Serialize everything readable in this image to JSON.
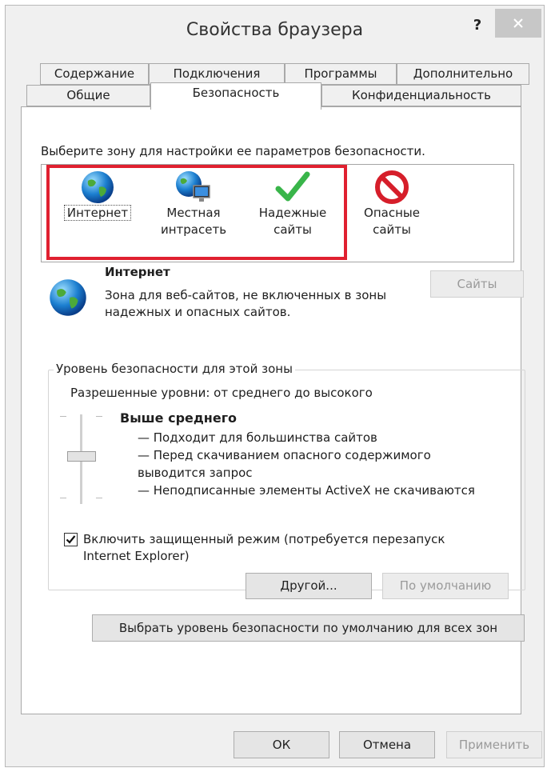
{
  "window": {
    "title": "Свойства браузера",
    "help": "?",
    "close_icon": "close-icon"
  },
  "tabs": {
    "row1": [
      "Содержание",
      "Подключения",
      "Программы",
      "Дополнительно"
    ],
    "row2": [
      "Общие",
      "Безопасность",
      "Конфиденциальность"
    ],
    "active": "Безопасность"
  },
  "zones": {
    "prompt": "Выберите зону для настройки ее параметров безопасности.",
    "items": [
      {
        "line1": "Интернет",
        "line2": "",
        "icon": "globe-icon"
      },
      {
        "line1": "Местная",
        "line2": "интрасеть",
        "icon": "intranet-icon"
      },
      {
        "line1": "Надежные",
        "line2": "сайты",
        "icon": "checkmark-icon"
      },
      {
        "line1": "Опасные",
        "line2": "сайты",
        "icon": "forbidden-icon"
      }
    ],
    "highlight_color": "#e02030"
  },
  "selected_zone": {
    "title": "Интернет",
    "desc_line1": "Зона для веб-сайтов, не включенных в зоны",
    "desc_line2": "надежных и опасных сайтов.",
    "sites_button": "Сайты"
  },
  "security_level": {
    "group_title": "Уровень безопасности для этой зоны",
    "allowed": "Разрешенные уровни: от среднего до высокого",
    "level_name": "Выше среднего",
    "bullet1": "— Подходит для большинства сайтов",
    "bullet2a": "— Перед скачиванием опасного содержимого",
    "bullet2b": "выводится запрос",
    "bullet3": "— Неподписанные элементы ActiveX не скачиваются",
    "protected_mode_line1": "Включить защищенный режим (потребуется перезапуск",
    "protected_mode_line2": "Internet Explorer)",
    "protected_mode_checked": true,
    "custom_button": "Другой...",
    "default_button": "По умолчанию"
  },
  "reset_all_button": "Выбрать уровень безопасности по умолчанию для всех зон",
  "footer": {
    "ok": "ОК",
    "cancel": "Отмена",
    "apply": "Применить"
  }
}
